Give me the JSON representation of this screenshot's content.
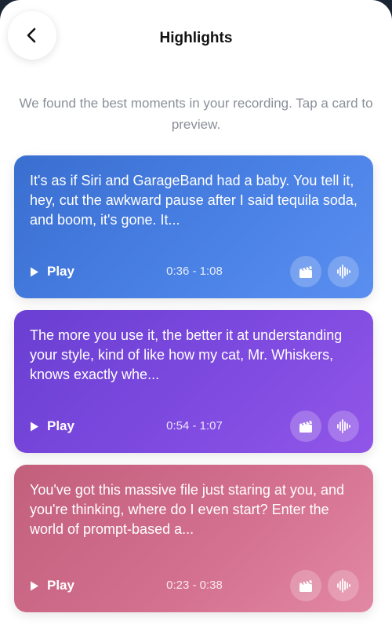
{
  "header": {
    "title": "Highlights",
    "back_icon": "chevron-left-icon"
  },
  "subtitle": "We found the best moments in your recording. Tap a card to preview.",
  "cards": [
    {
      "text": "It's as if Siri and GarageBand had a baby. You tell it, hey, cut the awkward pause after I said tequila soda, and boom, it's gone. It...",
      "play_label": "Play",
      "time_range": "0:36 - 1:08",
      "color": "#4b82e6"
    },
    {
      "text": "The more you use it, the better it at understanding your style, kind of like how my cat, Mr. Whiskers, knows exactly whe...",
      "play_label": "Play",
      "time_range": "0:54 - 1:07",
      "color": "#7e4ae0"
    },
    {
      "text": "You've got this massive file just staring at you, and you're thinking, where do I even start? Enter the world of prompt-based a...",
      "play_label": "Play",
      "time_range": "0:23 - 0:38",
      "color": "#d36f8f"
    }
  ],
  "icons": {
    "play": "play-icon",
    "clip": "clapperboard-icon",
    "audio": "waveform-icon"
  }
}
